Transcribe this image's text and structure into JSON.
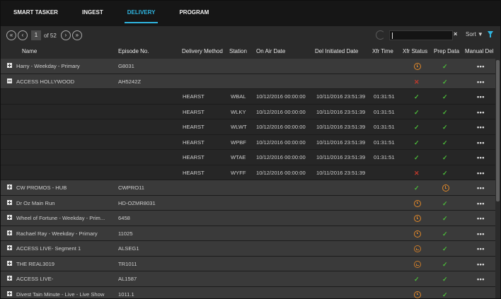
{
  "nav": {
    "tabs": [
      {
        "label": "SMART TASKER",
        "active": false
      },
      {
        "label": "INGEST",
        "active": false
      },
      {
        "label": "DELIVERY",
        "active": true
      },
      {
        "label": "PROGRAM",
        "active": false
      }
    ]
  },
  "toolbar": {
    "first_icon": "«",
    "prev_icon": "‹",
    "page_value": "1",
    "page_of": "of 52",
    "next_icon": "›",
    "last_icon": "»",
    "clear_icon": "×",
    "sort_label": "Sort ▼"
  },
  "columns": [
    "Name",
    "Episode No.",
    "Delivery Method",
    "Station",
    "On Air Date",
    "Del Initiated Date",
    "Xfr Time",
    "Xfr Status",
    "Prep Data",
    "Manual Del"
  ],
  "colors": {
    "accent": "#2fb5e0",
    "check": "#4cbb3a",
    "error": "#c0392b",
    "pending": "#e0882a"
  },
  "rows": [
    {
      "kind": "parent",
      "expand": "plus",
      "name": "Harry - Weekday - Primary",
      "episode": "G8031",
      "xfr": "clock",
      "prep": "check",
      "manual": "•••"
    },
    {
      "kind": "parent",
      "expand": "minus",
      "name": "ACCESS HOLLYWOOD",
      "episode": "AH5242Z",
      "xfr": "x",
      "prep": "check",
      "manual": "•••"
    },
    {
      "kind": "child",
      "method": "HEARST",
      "station": "WBAL",
      "air": "10/12/2016 00:00:00",
      "del": "10/11/2016 23:51:39",
      "xt": "01:31:51",
      "xfr": "check",
      "prep": "check",
      "manual": "•••"
    },
    {
      "kind": "child",
      "method": "HEARST",
      "station": "WLKY",
      "air": "10/12/2016 00:00:00",
      "del": "10/11/2016 23:51:39",
      "xt": "01:31:51",
      "xfr": "check",
      "prep": "check",
      "manual": "•••"
    },
    {
      "kind": "child",
      "method": "HEARST",
      "station": "WLWT",
      "air": "10/12/2016 00:00:00",
      "del": "10/11/2016 23:51:39",
      "xt": "01:31:51",
      "xfr": "check",
      "prep": "check",
      "manual": "•••"
    },
    {
      "kind": "child",
      "method": "HEARST",
      "station": "WPBF",
      "air": "10/12/2016 00:00:00",
      "del": "10/11/2016 23:51:39",
      "xt": "01:31:51",
      "xfr": "check",
      "prep": "check",
      "manual": "•••"
    },
    {
      "kind": "child",
      "method": "HEARST",
      "station": "WTAE",
      "air": "10/12/2016 00:00:00",
      "del": "10/11/2016 23:51:39",
      "xt": "01:31:51",
      "xfr": "check",
      "prep": "check",
      "manual": "•••"
    },
    {
      "kind": "child",
      "method": "HEARST",
      "station": "WYFF",
      "air": "10/12/2016 00:00:00",
      "del": "10/11/2016 23:51:39",
      "xt": "",
      "xfr": "x",
      "prep": "check",
      "manual": "•••"
    },
    {
      "kind": "parent",
      "expand": "plus",
      "name": "CW PROMOS - HUB",
      "episode": "CWPRO11",
      "xfr": "check",
      "prep": "clock",
      "manual": "•••"
    },
    {
      "kind": "parent",
      "expand": "plus",
      "name": "Dr Oz Main Run",
      "episode": "HD-OZMR8031",
      "xfr": "clock",
      "prep": "check",
      "manual": "•••"
    },
    {
      "kind": "parent",
      "expand": "plus",
      "name": "Wheel of Fortune - Weekday - Prim...",
      "episode": "6458",
      "xfr": "clock",
      "prep": "check",
      "manual": "•••"
    },
    {
      "kind": "parent",
      "expand": "plus",
      "name": "Rachael Ray - Weekday - Primary",
      "episode": "11025",
      "xfr": "clock",
      "prep": "check",
      "manual": "•••"
    },
    {
      "kind": "parent",
      "expand": "plus",
      "name": "ACCESS LIVE- Segment 1",
      "episode": "ALSEG1",
      "xfr": "pending",
      "prep": "check",
      "manual": "•••"
    },
    {
      "kind": "parent",
      "expand": "plus",
      "name": "THE REAL3019",
      "episode": "TR1011",
      "xfr": "pending",
      "prep": "check",
      "manual": "•••"
    },
    {
      "kind": "parent",
      "expand": "plus",
      "name": "ACCESS LIVE-",
      "episode": "AL1587",
      "xfr": "check",
      "prep": "check",
      "manual": "•••"
    },
    {
      "kind": "parent",
      "expand": "plus",
      "name": "Divest Tain Minute - Live - Live Show",
      "episode": "1011.1",
      "xfr": "clock",
      "prep": "check",
      "manual": ""
    }
  ]
}
